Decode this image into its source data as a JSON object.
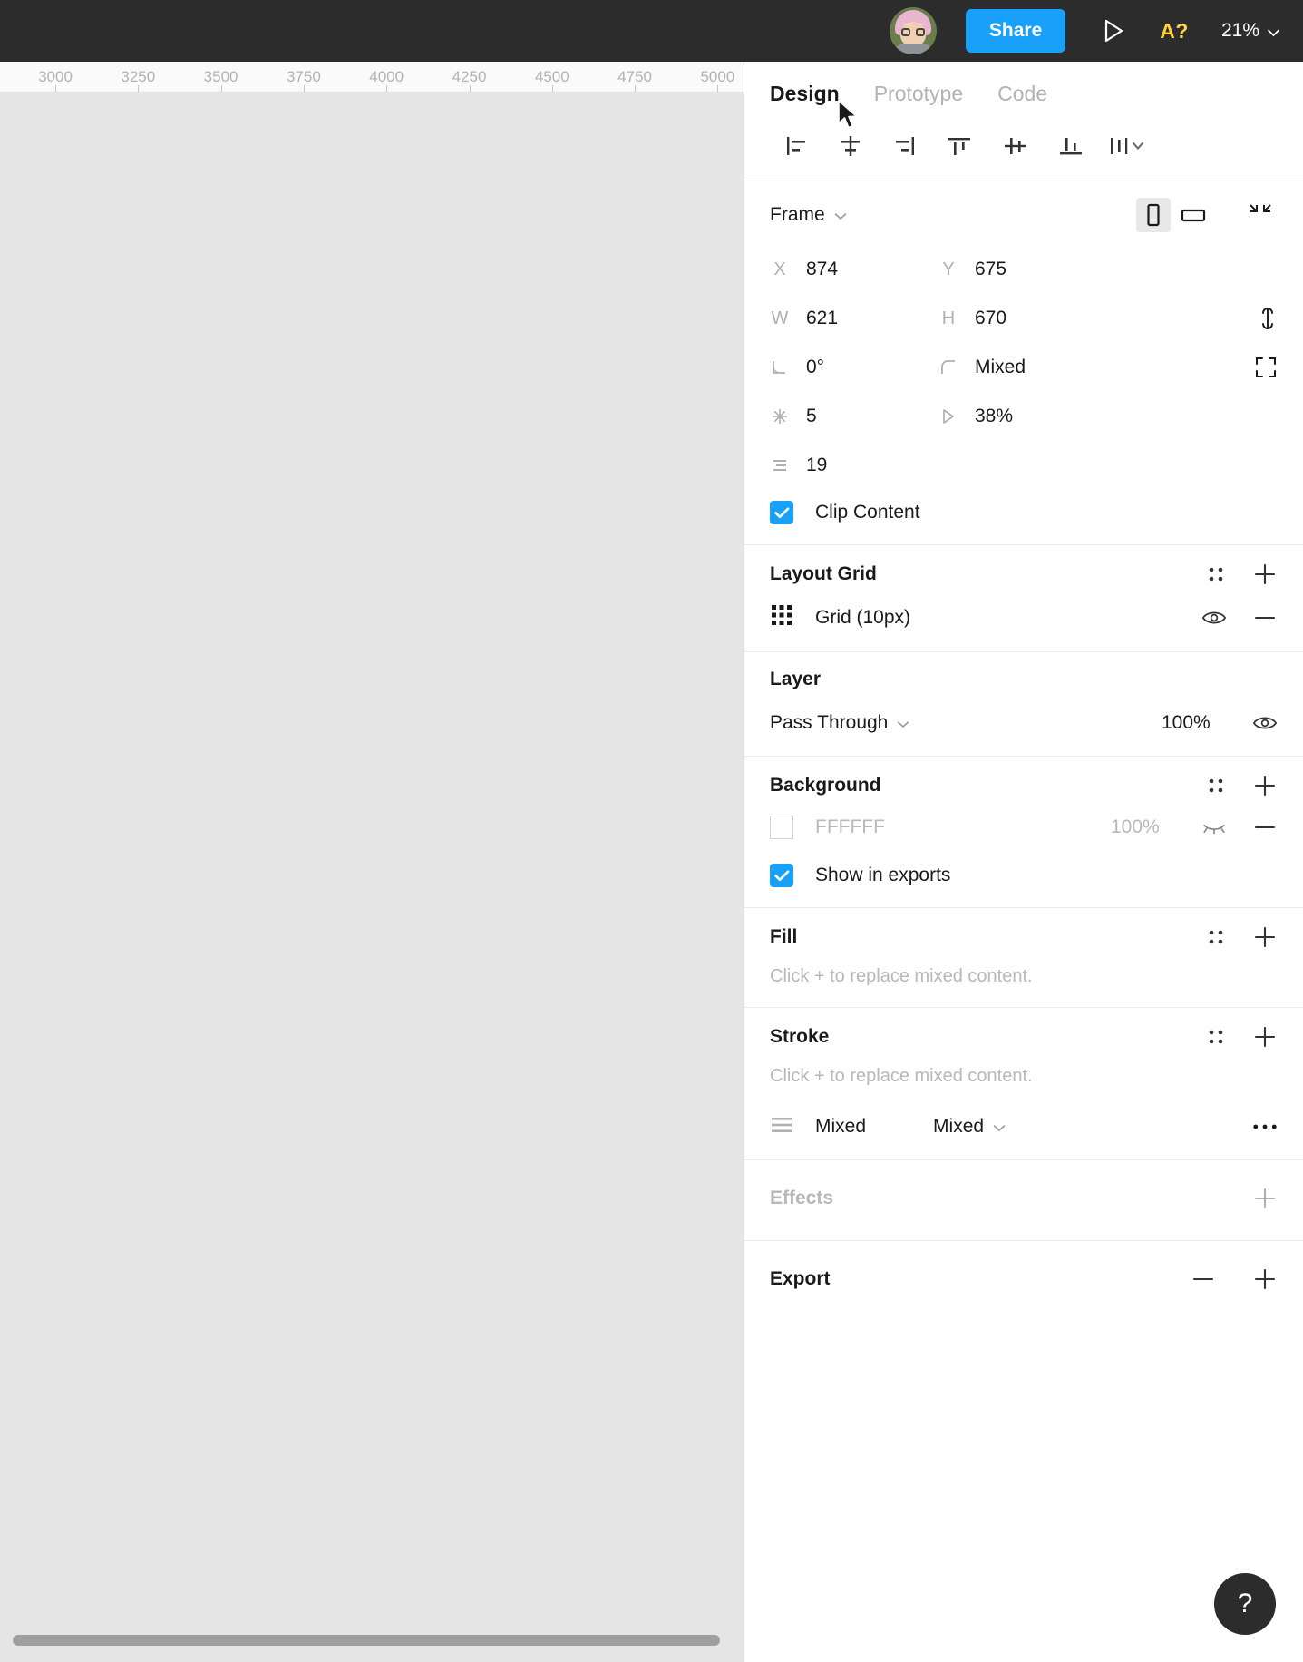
{
  "topbar": {
    "share_label": "Share",
    "present_icon": "play-triangle-icon",
    "avatar_icon": "user-avatar",
    "accessibility_badge": "A?",
    "zoom_level": "21%",
    "zoom_caret_icon": "chevron-down-icon",
    "bg_color": "#2c2c2c",
    "accent_color": "#18a0fb",
    "badge_color": "#ffd43b"
  },
  "canvas": {
    "ruler_ticks": [
      "3000",
      "3250",
      "3500",
      "3750",
      "4000",
      "4250",
      "4500",
      "4750",
      "5000"
    ],
    "bg_color": "#e5e5e5",
    "ruler_bg": "#fafafa"
  },
  "panel": {
    "tabs": [
      {
        "label": "Design",
        "active": true
      },
      {
        "label": "Prototype",
        "active": false
      },
      {
        "label": "Code",
        "active": false
      }
    ],
    "align_buttons": [
      "align-left-icon",
      "align-horizontal-center-icon",
      "align-right-icon",
      "align-top-icon",
      "align-vertical-center-icon",
      "align-bottom-icon",
      "distribute-more-icon"
    ],
    "frame": {
      "name": "Frame",
      "name_caret_icon": "chevron-down-icon",
      "orientation_portrait_icon": "portrait-frame-icon",
      "orientation_landscape_icon": "landscape-frame-icon",
      "collapse_icon": "collapse-arrows-icon",
      "props": [
        {
          "icon": "x-position-icon",
          "label": "X",
          "value": "874",
          "icon2": "y-position-icon",
          "label2": "Y",
          "value2": "675",
          "extra": ""
        },
        {
          "icon": "width-icon",
          "label": "W",
          "value": "621",
          "icon2": "height-icon",
          "label2": "H",
          "value2": "670",
          "extra": "constrain-proportions-icon"
        },
        {
          "icon": "rotation-icon",
          "label": "",
          "value": "0°",
          "icon2": "corner-radius-icon",
          "label2": "",
          "value2": "Mixed",
          "extra": "independent-corners-icon"
        },
        {
          "icon": "layout-spacing-icon",
          "label": "",
          "value": "5",
          "icon2": "padding-icon",
          "label2": "",
          "value2": "38%",
          "extra": ""
        },
        {
          "icon": "vertical-spacing-icon",
          "label": "",
          "value": "19",
          "icon2": "",
          "label2": "",
          "value2": "",
          "extra": ""
        }
      ],
      "clip_content_label": "Clip Content",
      "clip_content_checked": true
    },
    "layout_grid": {
      "title": "Layout Grid",
      "styles_icon": "styles-grid-icon",
      "add_icon": "plus-icon",
      "item_icon": "grid-dots-icon",
      "item_label": "Grid (10px)",
      "visibility_icon": "eye-icon",
      "remove_icon": "minus-icon"
    },
    "layer": {
      "title": "Layer",
      "blend_mode": "Pass Through",
      "blend_caret_icon": "chevron-down-icon",
      "opacity": "100%",
      "visibility_icon": "eye-icon"
    },
    "background": {
      "title": "Background",
      "styles_icon": "styles-grid-icon",
      "add_icon": "plus-icon",
      "color_hex": "FFFFFF",
      "opacity": "100%",
      "visibility_icon": "eye-closed-icon",
      "remove_icon": "minus-icon",
      "show_in_exports_label": "Show in exports",
      "show_in_exports_checked": true
    },
    "fill": {
      "title": "Fill",
      "styles_icon": "styles-grid-icon",
      "add_icon": "plus-icon",
      "hint": "Click + to replace mixed content."
    },
    "stroke": {
      "title": "Stroke",
      "styles_icon": "styles-grid-icon",
      "add_icon": "plus-icon",
      "hint": "Click + to replace mixed content.",
      "align_icon": "stroke-align-icon",
      "align_value": "Mixed",
      "weight_value": "Mixed",
      "weight_caret_icon": "chevron-down-icon",
      "more_icon": "ellipsis-icon"
    },
    "effects": {
      "title": "Effects",
      "add_icon": "plus-icon"
    },
    "export": {
      "title": "Export",
      "remove_icon": "minus-icon",
      "add_icon": "plus-icon"
    },
    "help_label": "?"
  }
}
